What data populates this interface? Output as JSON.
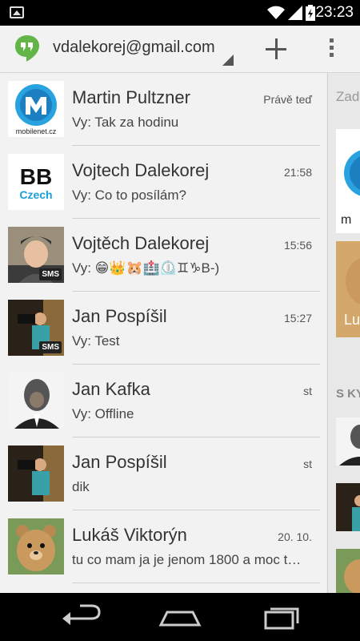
{
  "status_bar": {
    "time": "23:23"
  },
  "action_bar": {
    "account": "vdalekorej@gmail.com"
  },
  "conversations": [
    {
      "name": "Martin Pultzner",
      "time": "Právě teď",
      "snippet": "Vy: Tak za hodinu",
      "avatar_text": "mobilenet.cz",
      "sms": false
    },
    {
      "name": "Vojtech Dalekorej",
      "time": "21:58",
      "snippet": "Vy: Co to posílám?",
      "avatar_text": "BB Czech",
      "sms": false
    },
    {
      "name": "Vojtěch Dalekorej",
      "time": "15:56",
      "snippet": "Vy: 😁👑🐹🏥⏲️♊♑B-)",
      "sms": true,
      "sms_label": "SMS"
    },
    {
      "name": "Jan Pospíšil",
      "time": "15:27",
      "snippet": "Vy: Test",
      "sms": true,
      "sms_label": "SMS"
    },
    {
      "name": "Jan Kafka",
      "time": "st",
      "snippet": "Vy: Offline",
      "sms": false
    },
    {
      "name": "Jan Pospíšil",
      "time": "st",
      "snippet": "dik",
      "sms": false
    },
    {
      "name": "Lukáš Viktorýn",
      "time": "20. 10.",
      "snippet": "tu co mam ja je jenom 1800 a moc t…",
      "sms": false
    }
  ],
  "peek_panel": {
    "search_hint": "Zad",
    "section_label": "S KY",
    "card_label": "Lu"
  },
  "colors": {
    "hangouts_green": "#62b546",
    "blue": "#29a3e0"
  }
}
